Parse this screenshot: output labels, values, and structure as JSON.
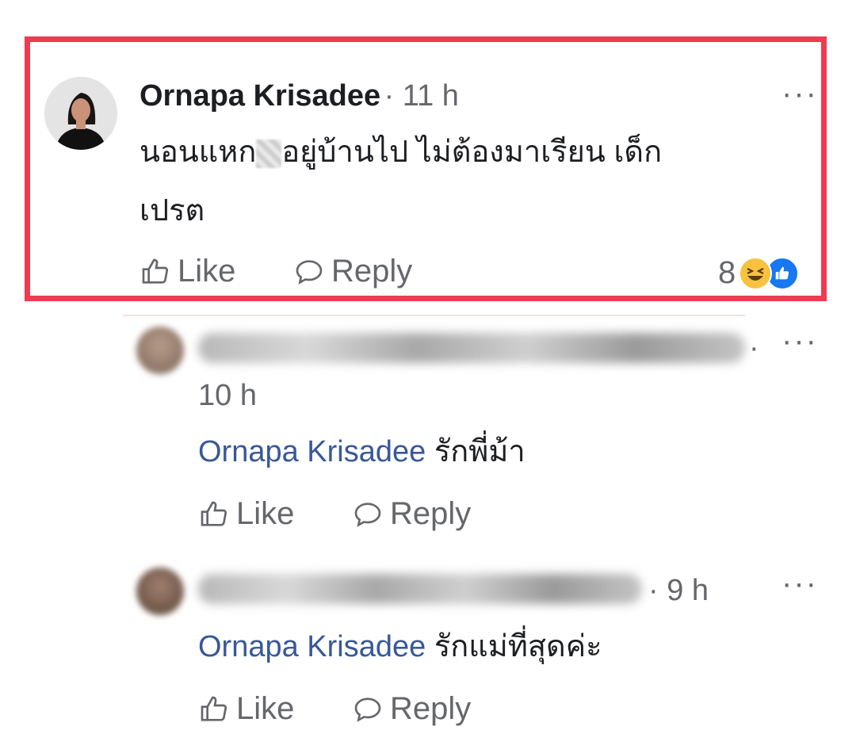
{
  "main_comment": {
    "author": "Ornapa Krisadee",
    "time": "· 11 h",
    "text_part1": "นอนแหก",
    "text_part2": "อยู่บ้านไป ไม่ต้องมาเรียน เด็ก",
    "text_line2": "เปรต",
    "like_label": "Like",
    "reply_label": "Reply",
    "reaction_count": "8",
    "more_label": "···"
  },
  "replies": [
    {
      "time": "10 h",
      "mention": "Ornapa Krisadee",
      "text": "รักพี่ม้า",
      "like_label": "Like",
      "reply_label": "Reply",
      "more_label": "···"
    },
    {
      "time": "· 9 h",
      "mention": "Ornapa Krisadee",
      "text": "รักแม่ที่สุดค่ะ",
      "like_label": "Like",
      "reply_label": "Reply",
      "more_label": "···"
    }
  ],
  "icons": {
    "like": "thumbs-up-outline-icon",
    "reply": "speech-bubble-icon",
    "haha": "haha-emoji-icon",
    "like_reaction": "like-reaction-icon",
    "more": "more-options-icon"
  },
  "colors": {
    "highlight_border": "#ef3b50",
    "mention": "#385898",
    "muted": "#65676b",
    "like_blue": "#1877f2",
    "haha_yellow": "#f7c33f"
  }
}
